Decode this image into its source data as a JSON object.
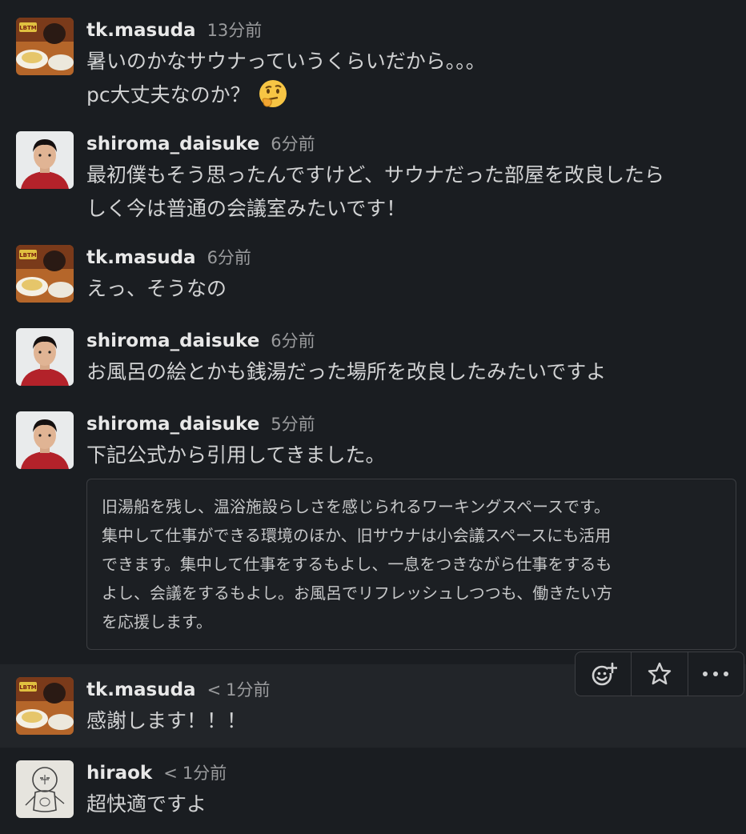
{
  "messages": [
    {
      "author": "tk.masuda",
      "time": "13分前",
      "lines": [
        "暑いのかなサウナっていうくらいだから。。。",
        "pc大丈夫なのか？"
      ],
      "emoji": "thinking-face"
    },
    {
      "author": "shiroma_daisuke",
      "time": "6分前",
      "lines": [
        "最初僕もそう思ったんですけど、サウナだった部屋を改良したら",
        "しく今は普通の会議室みたいです！"
      ]
    },
    {
      "author": "tk.masuda",
      "time": "6分前",
      "lines": [
        "えっ、そうなの"
      ]
    },
    {
      "author": "shiroma_daisuke",
      "time": "6分前",
      "lines": [
        "お風呂の絵とかも銭湯だった場所を改良したみたいですよ"
      ]
    },
    {
      "author": "shiroma_daisuke",
      "time": "5分前",
      "lines": [
        "下記公式から引用してきました。"
      ],
      "quote": [
        "旧湯船を残し、温浴施設らしさを感じられるワーキングスペースです。",
        "集中して仕事ができる環境のほか、旧サウナは小会議スペースにも活用",
        "できます。集中して仕事をするもよし、一息をつきながら仕事をするも",
        "よし、会議をするもよし。お風呂でリフレッシュしつつも、働きたい方",
        "を応援します。"
      ]
    },
    {
      "author": "tk.masuda",
      "time_prefix": "<",
      "time": "1分前",
      "lines": [
        "感謝します！！！"
      ]
    },
    {
      "author": "hiraok",
      "time_prefix": "<",
      "time": "1分前",
      "lines": [
        "超快適ですよ"
      ]
    }
  ],
  "toolbar": {
    "buttons": [
      "add-reaction-icon",
      "star-icon",
      "more-actions-icon"
    ]
  },
  "colors": {
    "background": "#1a1d21",
    "hover_background": "#222529",
    "text": "#d1d2d3",
    "muted": "#9a9b9d"
  }
}
